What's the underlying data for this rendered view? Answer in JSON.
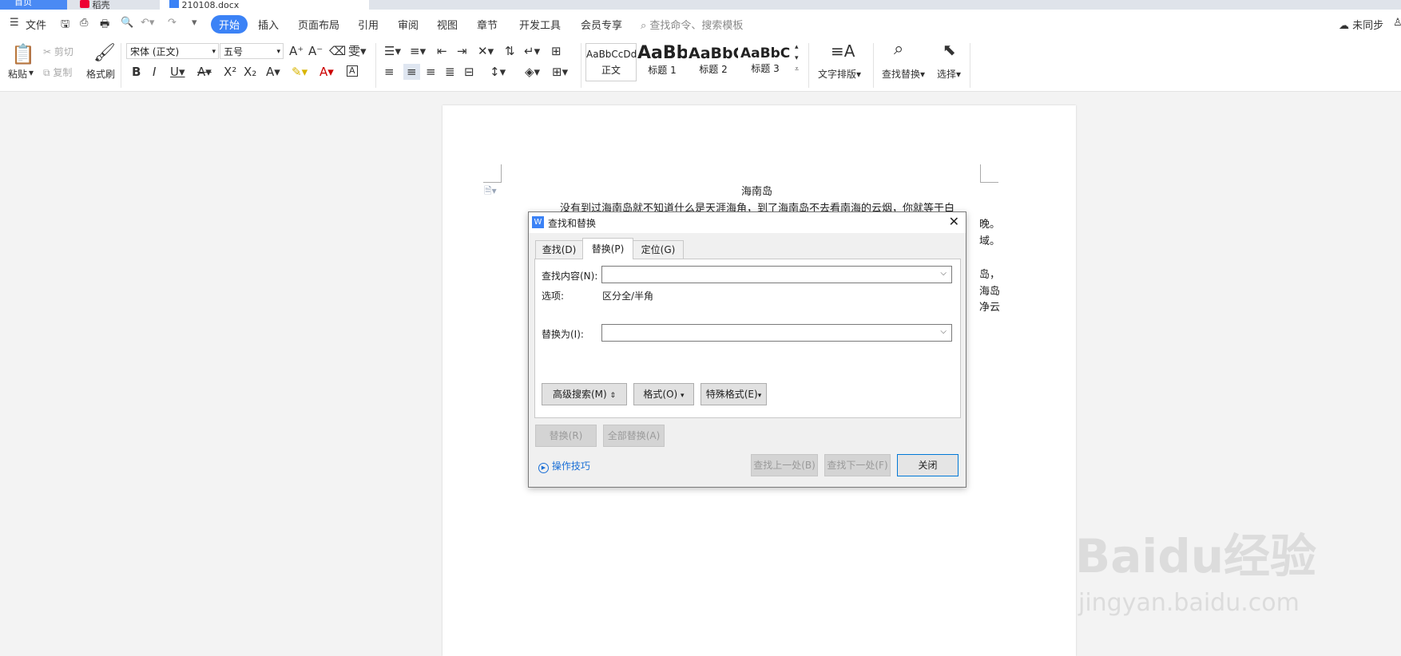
{
  "tabs": [
    {
      "label": "首页"
    },
    {
      "label": "稻壳"
    },
    {
      "label": "210108.docx"
    }
  ],
  "menubar": {
    "file": "文件",
    "items": [
      "开始",
      "插入",
      "页面布局",
      "引用",
      "审阅",
      "视图",
      "章节",
      "开发工具",
      "会员专享"
    ],
    "search_placeholder": "查找命令、搜索模板",
    "sync_status": "未同步"
  },
  "ribbon": {
    "paste": "粘贴",
    "cut": "剪切",
    "copy": "复制",
    "format_painter": "格式刷",
    "font_name": "宋体 (正文)",
    "font_size": "五号",
    "styles": [
      {
        "preview": "AaBbCcDd",
        "name": "正文"
      },
      {
        "preview": "AaBb",
        "name": "标题 1"
      },
      {
        "preview": "AaBbC",
        "name": "标题 2"
      },
      {
        "preview": "AaBbC",
        "name": "标题 3"
      }
    ],
    "text_layout": "文字排版",
    "find_replace": "查找替换",
    "select": "选择"
  },
  "document": {
    "title": "海南岛",
    "line1": "没有到过海南岛就不知道什么是天涯海角，到了海南岛不去看南海的云烟，你就等于白",
    "right_fragments": [
      "晚。",
      "域。",
      "岛，",
      "海岛",
      "净云"
    ]
  },
  "dialog": {
    "title": "查找和替换",
    "tabs": [
      "查找(D)",
      "替换(P)",
      "定位(G)"
    ],
    "active_tab": 1,
    "find_label": "查找内容(N):",
    "find_value": "",
    "options_label": "选项:",
    "options_value": "区分全/半角",
    "replace_label": "替换为(I):",
    "replace_value": "",
    "advanced_search": "高级搜索(M)",
    "format": "格式(O)",
    "special_format": "特殊格式(E)",
    "replace_button": "替换(R)",
    "replace_all_button": "全部替换(A)",
    "tips_link": "操作技巧",
    "find_prev": "查找上一处(B)",
    "find_next": "查找下一处(F)",
    "close": "关闭"
  },
  "watermark": {
    "brand": "Baidu经验",
    "url": "jingyan.baidu.com"
  },
  "colors": {
    "accent": "#3b82f6",
    "link": "#1a6fd6"
  }
}
